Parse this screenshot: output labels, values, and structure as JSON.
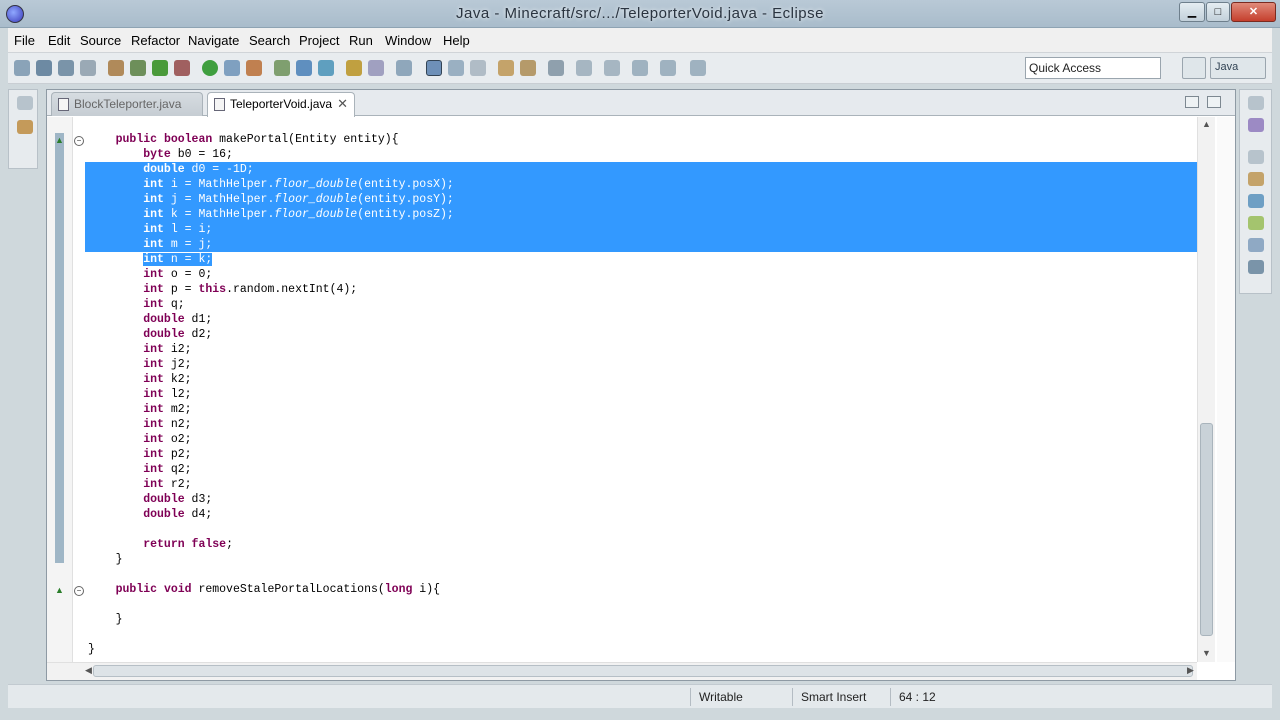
{
  "window": {
    "title": "Java - Minecraft/src/.../TeleporterVoid.java - Eclipse",
    "minimize": "▁",
    "maximize": "□",
    "close": "✕"
  },
  "menu": [
    "File",
    "Edit",
    "Source",
    "Refactor",
    "Navigate",
    "Search",
    "Project",
    "Run",
    "Window",
    "Help"
  ],
  "toolbar": {
    "quick_access": "Quick Access",
    "perspective_label": "Java"
  },
  "tabs": [
    {
      "label": "BlockTeleporter.java",
      "active": false
    },
    {
      "label": "TeleporterVoid.java",
      "active": true,
      "close": "✕"
    }
  ],
  "code_lines": [
    "    public boolean makePortal(Entity entity){",
    "        byte b0 = 16;",
    "        double d0 = -1D;",
    "        int i = MathHelper.floor_double(entity.posX);",
    "        int j = MathHelper.floor_double(entity.posY);",
    "        int k = MathHelper.floor_double(entity.posZ);",
    "        int l = i;",
    "        int m = j;",
    "        int n = k;",
    "        int o = 0;",
    "        int p = this.random.nextInt(4);",
    "        int q;",
    "        double d1;",
    "        double d2;",
    "        int i2;",
    "        int j2;",
    "        int k2;",
    "        int l2;",
    "        int m2;",
    "        int n2;",
    "        int o2;",
    "        int p2;",
    "        int q2;",
    "        int r2;",
    "        double d3;",
    "        double d4;",
    "",
    "        return false;",
    "    }",
    "",
    "    public void removeStalePortalLocations(long i){",
    "",
    "    }",
    "",
    "}"
  ],
  "status": {
    "writable": "Writable",
    "insert_mode": "Smart Insert",
    "position": "64 : 12"
  }
}
